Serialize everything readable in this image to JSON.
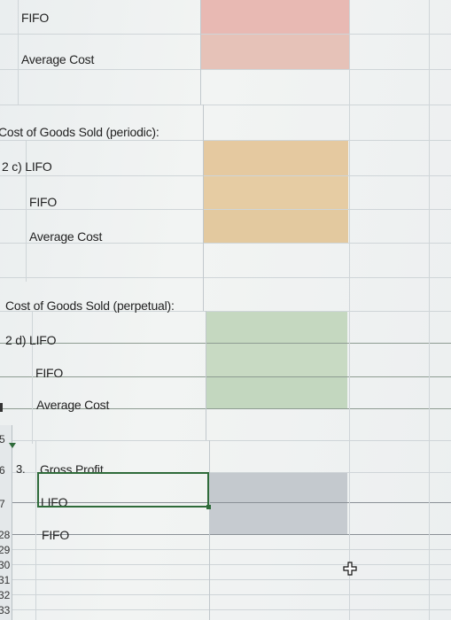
{
  "labels": {
    "fifo_top": "FIFO",
    "avg_top": "Average Cost",
    "cogs_periodic": "Cost of Goods Sold (periodic):",
    "p_lifo": "2 c) LIFO",
    "p_fifo": "FIFO",
    "p_avg": "Average Cost",
    "cogs_perpetual": "Cost of Goods Sold (perpetual):",
    "q_lifo": "2 d)  LIFO",
    "q_fifo": "FIFO",
    "q_avg": "Average Cost",
    "gp_num": "3.",
    "gp_title": "Gross Profit",
    "gp_lifo": "LIFO",
    "gp_fifo": "FIFO"
  },
  "row_numbers": {
    "r5": "5",
    "r6": "6",
    "r7": "7",
    "r28": "28",
    "r29": "29",
    "r30": "30",
    "r31": "31",
    "r32": "32",
    "r33": "33"
  },
  "colors": {
    "pink": "#e8b9b3",
    "peach": "#e5c9a0",
    "green": "#c5d8c0",
    "gray": "#c4c9ce",
    "selection": "#2f6b3a"
  }
}
